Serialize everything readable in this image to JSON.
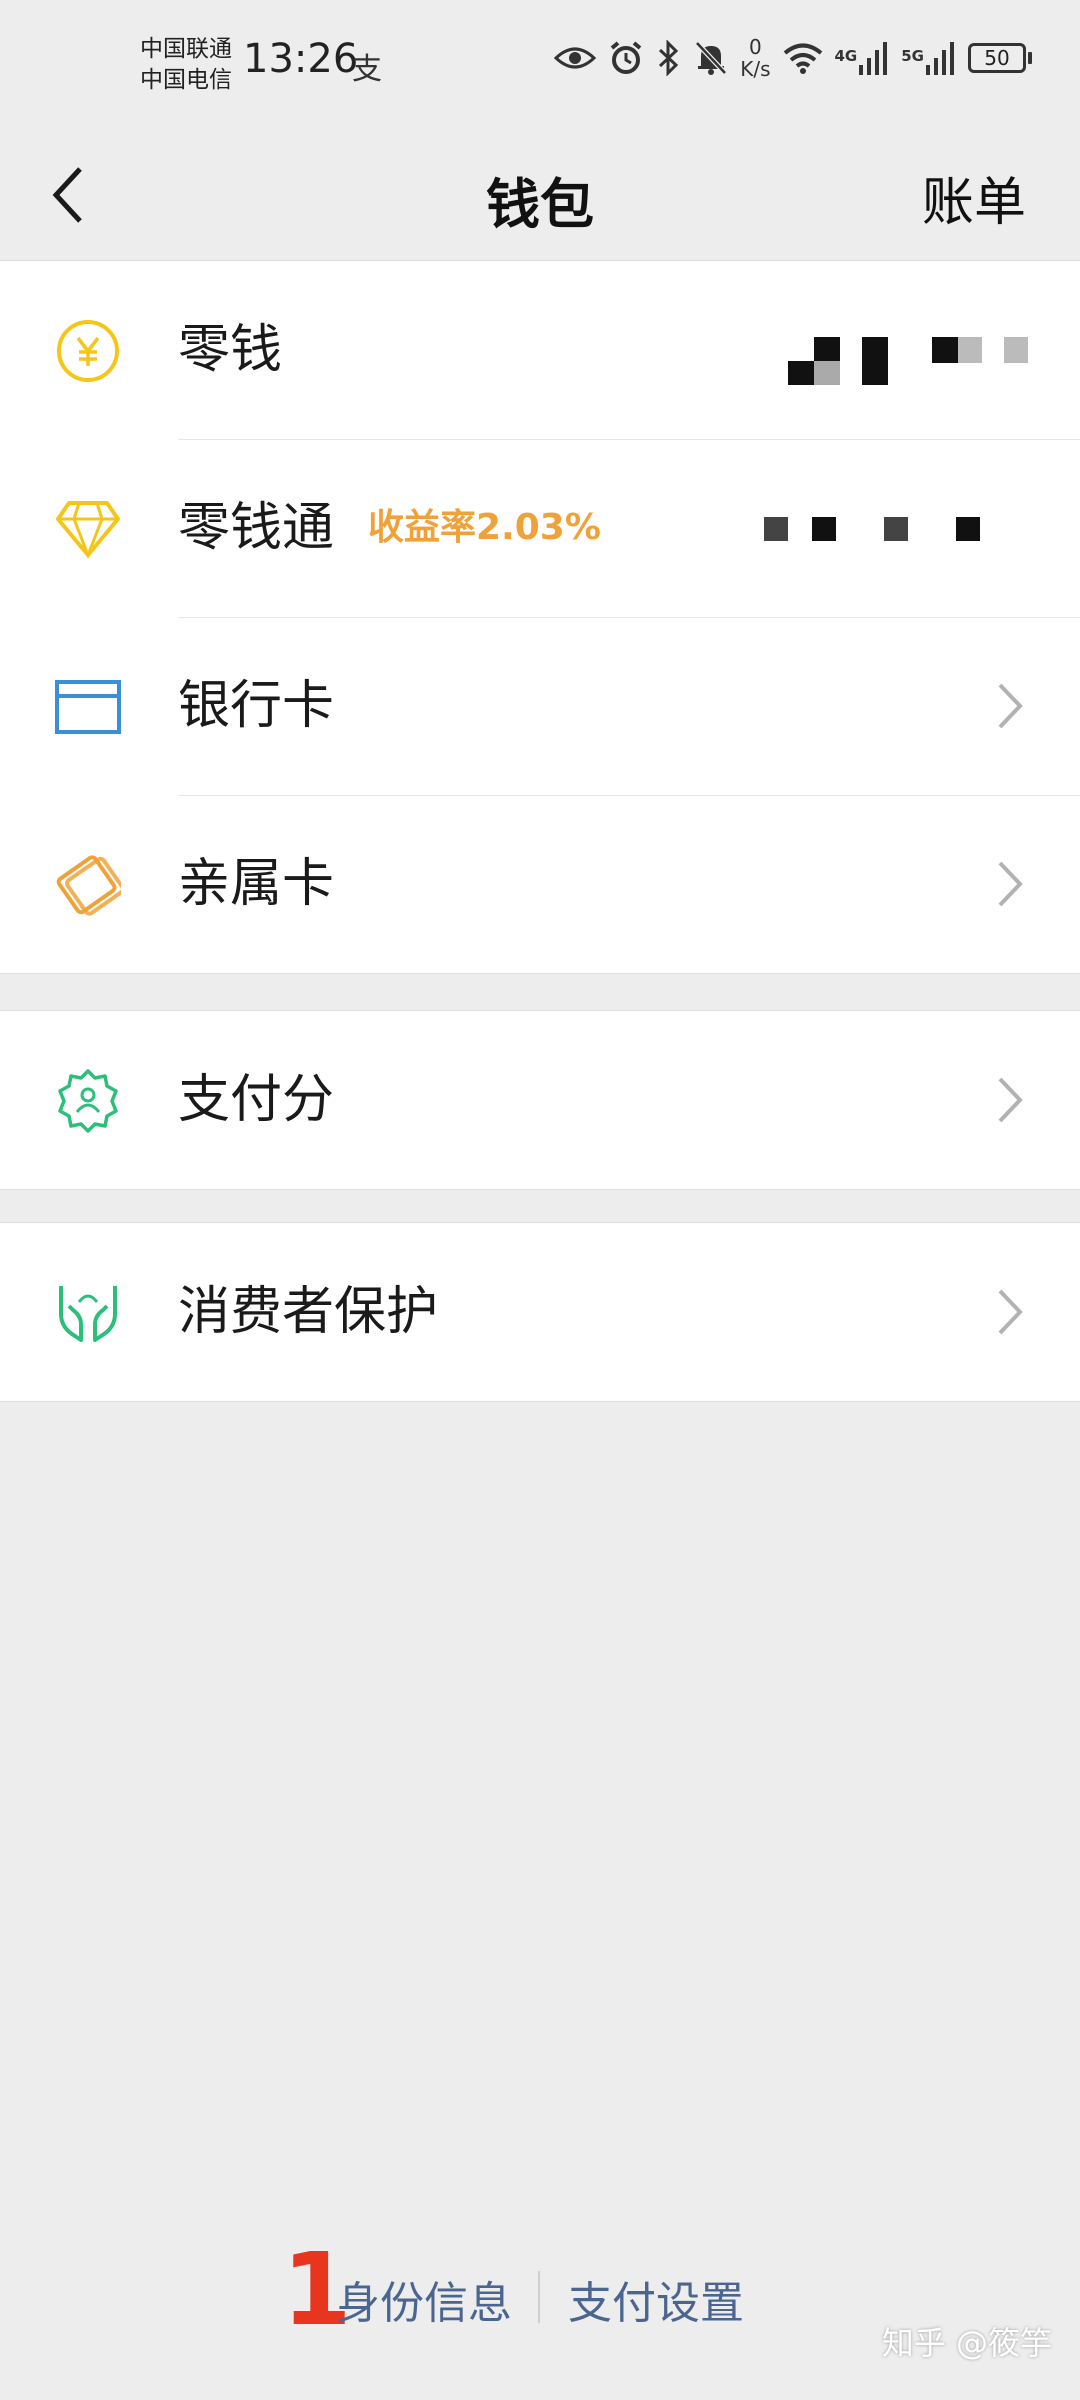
{
  "status_bar": {
    "carrier_1": "中国联通",
    "carrier_2": "中国电信",
    "time": "13:26",
    "app_glyph": "支",
    "net_speed_value": "0",
    "net_speed_unit": "K/s",
    "signal_1_label": "4G",
    "signal_2_label": "5G",
    "battery_level": "50",
    "icons": [
      "eye-icon",
      "alarm-icon",
      "bluetooth-icon",
      "mute-bell-icon",
      "wifi-icon",
      "signal-icon",
      "signal-icon",
      "battery-icon"
    ]
  },
  "nav": {
    "title": "钱包",
    "bill_label": "账单",
    "back_icon": "chevron-left-icon"
  },
  "wallet_items": [
    {
      "label": "零钱",
      "icon": "yen-circle-icon",
      "color": "#f5c518"
    },
    {
      "label": "零钱通",
      "badge": "收益率2.03%",
      "icon": "diamond-icon",
      "color": "#f5c518"
    },
    {
      "label": "银行卡",
      "icon": "bank-card-icon",
      "color": "#3a8fd6"
    },
    {
      "label": "亲属卡",
      "icon": "family-card-icon",
      "color": "#f0a23a"
    }
  ],
  "credit_items": [
    {
      "label": "支付分",
      "icon": "pay-score-icon",
      "color": "#2bbf7a"
    }
  ],
  "protection_items": [
    {
      "label": "消费者保护",
      "icon": "protection-hands-icon",
      "color": "#2bbf7a"
    }
  ],
  "bottom": {
    "number_marker": "1",
    "identity_link": "身份信息",
    "pay_settings_link": "支付设置",
    "watermark": "知乎 @筱竽"
  },
  "colors": {
    "background": "#ededed",
    "badge_orange": "#f0a23a",
    "link_blue": "#4a6690",
    "marker_red": "#e8361e"
  }
}
